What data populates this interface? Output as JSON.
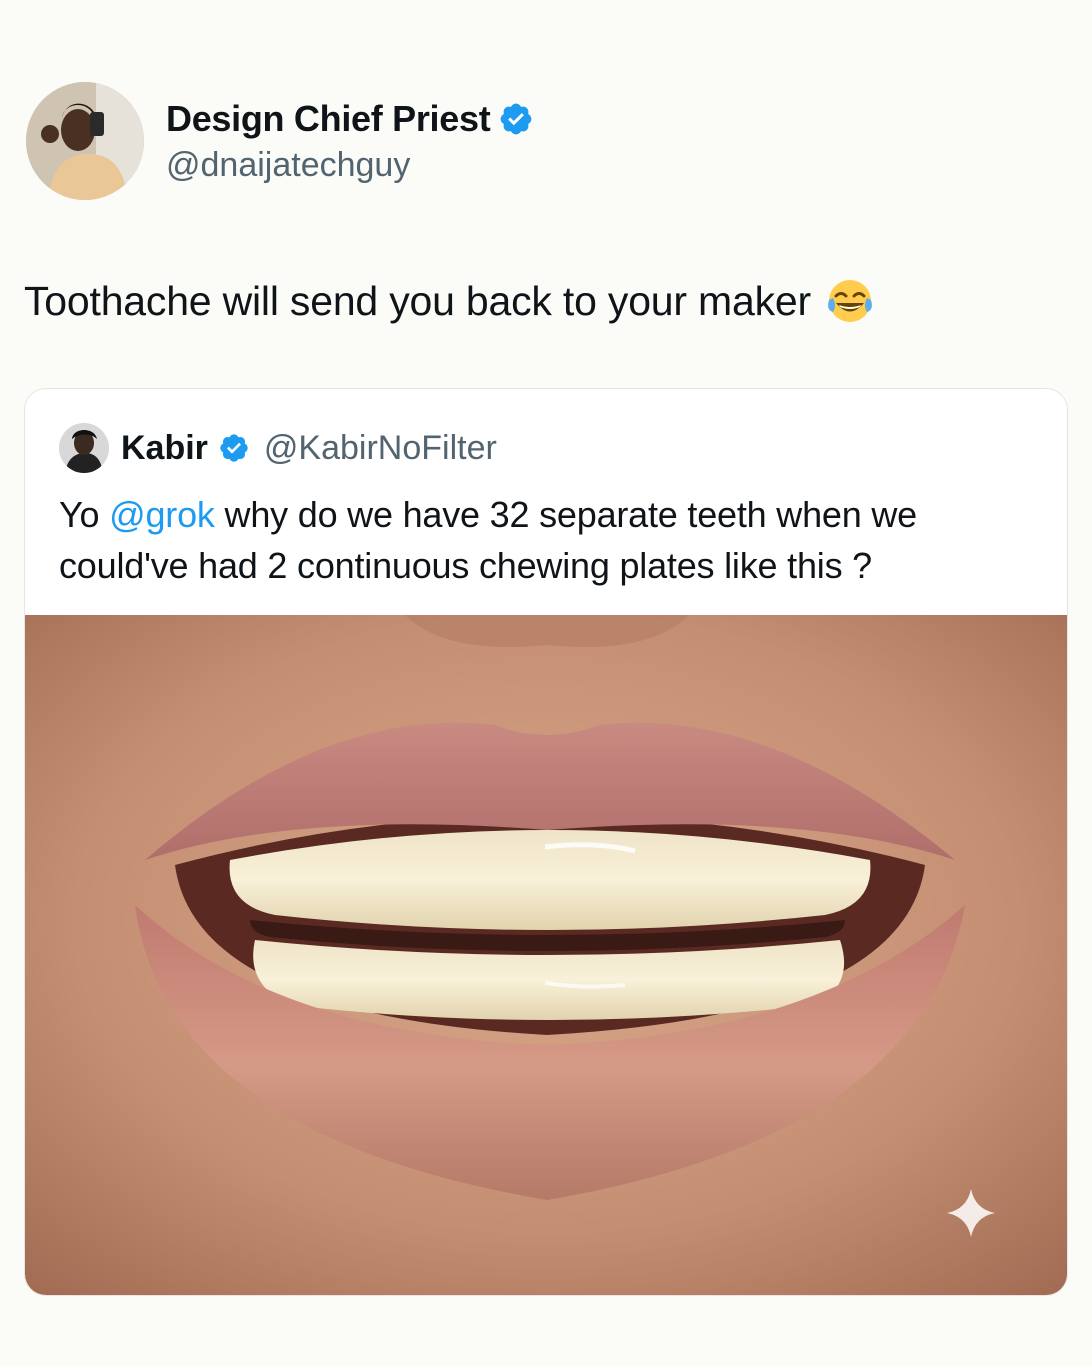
{
  "tweet": {
    "author": {
      "display_name": "Design Chief Priest",
      "handle": "@dnaijatechguy",
      "verified": true,
      "avatar_icon": "profile-photo"
    },
    "text": "Toothache will send you back to your maker",
    "emoji": "face-with-tears-of-joy"
  },
  "quote": {
    "author": {
      "display_name": "Kabir",
      "handle": "@KabirNoFilter",
      "verified": true,
      "avatar_icon": "profile-photo"
    },
    "text_parts": {
      "before": "Yo ",
      "mention": "@grok",
      "after": " why do we have 32 separate teeth when we could've had 2 continuous chewing plates like this ?"
    },
    "image_icon": "sparkle-icon"
  },
  "colors": {
    "verified_badge": "#1d9bf0",
    "mention": "#1d9bf0",
    "handle": "#536471"
  }
}
